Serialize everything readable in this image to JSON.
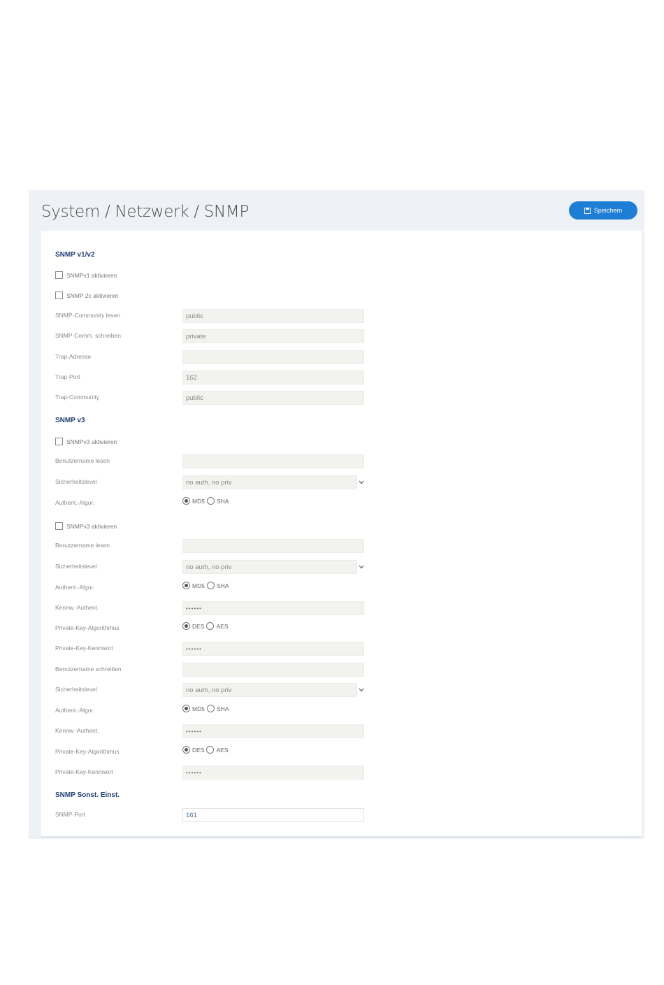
{
  "header": {
    "title": "System / Netzwerk / SNMP",
    "save_label": "Speichern"
  },
  "v12": {
    "section_title": "SNMP v1/v2",
    "cb_v1": "SNMPv1 aktivieren",
    "cb_v2c": "SNMP 2c aktivieren",
    "community_read_label": "SNMP-Community lesen",
    "community_read_value": "public",
    "community_write_label": "SNMP-Comm. schreiben",
    "community_write_value": "private",
    "trap_address_label": "Trap-Adresse",
    "trap_address_value": "",
    "trap_port_label": "Trap-Port",
    "trap_port_value": "162",
    "trap_community_label": "Trap-Community",
    "trap_community_value": "public"
  },
  "v3a": {
    "section_title": "SNMP v3",
    "cb_v3": "SNMPv3 aktivieren",
    "user_read_label": "Benutzername lesen",
    "security_label": "Sicherheitslevel",
    "security_value": "no auth, no priv",
    "auth_algo_label": "Authent.-Algor.",
    "md5": "MD5",
    "sha": "SHA"
  },
  "v3b": {
    "cb_v3": "SNMPv3 aktivieren",
    "user_read_label": "Benutzername lesen",
    "security_label": "Sicherheitslevel",
    "security_value": "no auth, no priv",
    "auth_algo_label": "Authent.-Algor.",
    "md5": "MD5",
    "sha": "SHA",
    "auth_pw_label": "Kennw.-Authent.",
    "auth_pw_value": "••••••",
    "priv_algo_label": "Private-Key-Algorithmus",
    "des": "DES",
    "aes": "AES",
    "priv_pw_label": "Private-Key-Kennwort",
    "priv_pw_value": "••••••",
    "user_write_label": "Benutzername schreiben",
    "security2_label": "Sicherheitslevel",
    "security2_value": "no auth, no priv",
    "auth_algo2_label": "Authent.-Algor.",
    "auth_pw2_label": "Kennw.-Authent.",
    "auth_pw2_value": "••••••",
    "priv_algo2_label": "Private-Key-Algorithmus",
    "priv_pw2_label": "Private-Key-Kennwort",
    "priv_pw2_value": "••••••"
  },
  "misc": {
    "section_title": "SNMP Sonst. Einst.",
    "port_label": "SNMP-Port",
    "port_value": "161"
  }
}
